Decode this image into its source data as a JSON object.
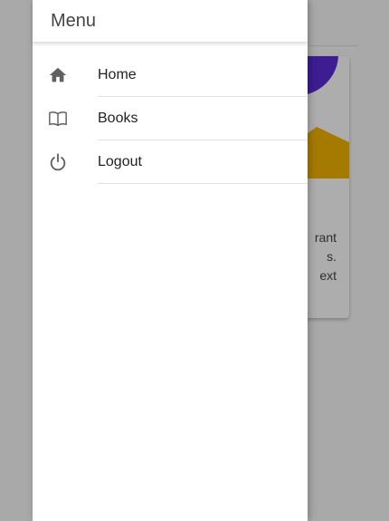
{
  "background_card": {
    "text": "rant\ns.\next"
  },
  "drawer": {
    "title": "Menu",
    "items": [
      {
        "label": "Home",
        "icon": "home-icon"
      },
      {
        "label": "Books",
        "icon": "book-icon"
      },
      {
        "label": "Logout",
        "icon": "power-icon"
      }
    ]
  },
  "colors": {
    "accent_purple": "#5a2bd6",
    "accent_yellow": "#f4b400",
    "scrim": "rgba(0,0,0,0.32)"
  }
}
